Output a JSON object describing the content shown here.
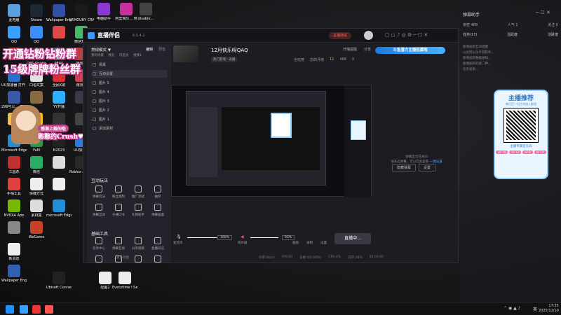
{
  "desktop": {
    "col1": [
      {
        "l": "此电脑",
        "c": "#5aa0e0"
      },
      {
        "l": "QQ",
        "c": "#3aa0ff"
      },
      {
        "l": "",
        "c": "#c04040"
      },
      {
        "l": "UU加速器 打开 小组件",
        "c": "#2a70c8"
      },
      {
        "l": "299号公... 产品号",
        "c": "#3a58a8"
      },
      {
        "l": "",
        "c": "#f0c040"
      },
      {
        "l": "Microsoft Edge",
        "c": "#1f8fd8"
      },
      {
        "l": "三国杀",
        "c": "#c03030"
      },
      {
        "l": "手柄工具",
        "c": "#e04040"
      },
      {
        "l": "NVIDIA App",
        "c": "#76b900"
      },
      {
        "l": "",
        "c": "#888"
      },
      {
        "l": "新消息",
        "c": "#eee"
      },
      {
        "l": "Wallpaper Engine",
        "c": "#3060b0"
      }
    ],
    "col2": [
      {
        "l": "Steam",
        "c": "#1b2838"
      },
      {
        "l": "QQ",
        "c": "#3a90ff"
      },
      {
        "l": "OBS Studio",
        "c": "#302e31"
      },
      {
        "l": "口语文案",
        "c": "#e0e0e0"
      },
      {
        "l": "",
        "c": "#8a6a40"
      },
      {
        "l": "YY语音",
        "c": "#f4c20d"
      },
      {
        "l": "FaM",
        "c": "#2a9a4a"
      },
      {
        "l": "微信",
        "c": "#2aae67"
      },
      {
        "l": "快捷方式",
        "c": "#eee"
      },
      {
        "l": "素材集",
        "c": "#ddd"
      },
      {
        "l": "WeGame",
        "c": "#c8402a"
      }
    ],
    "col3": [
      {
        "l": "Wallpaper Engine...",
        "c": "#3050a8"
      },
      {
        "l": "",
        "c": "#e04848"
      },
      {
        "l": "PEAK",
        "c": "#4a6080"
      },
      {
        "l": "全民K歌",
        "c": "#d83030"
      },
      {
        "l": "YY开播",
        "c": "#2ab0ff"
      },
      {
        "l": "",
        "c": "#333"
      },
      {
        "l": "N2023",
        "c": "#222"
      },
      {
        "l": "",
        "c": "#ddd"
      },
      {
        "l": "",
        "c": "#eee"
      },
      {
        "l": "microsoft Edge",
        "c": "#1f8fd8"
      }
    ],
    "col4": [
      {
        "l": "ARMOURY CRATE",
        "c": "#1a1a1a"
      },
      {
        "l": "微信开发",
        "c": "#44bb66"
      },
      {
        "l": "播放器",
        "c": "#b84040"
      },
      {
        "l": "南京...",
        "c": "#d04050"
      },
      {
        "l": "",
        "c": "#3a3a4a"
      },
      {
        "l": "",
        "c": "#444"
      },
      {
        "l": "UU加速器",
        "c": "#2a7ae0"
      },
      {
        "l": "Roblox Player",
        "c": "#2a2a2a"
      }
    ],
    "extra": [
      {
        "l": "电脑助手",
        "c": "#8a3ad0"
      },
      {
        "l": "阿里简历... 地",
        "c": "#c830a0"
      },
      {
        "l": "disable...",
        "c": "#444"
      },
      {
        "l": "配图2",
        "c": "#eee"
      },
      {
        "l": "Everytime I See a Dl...",
        "c": "#eee"
      },
      {
        "l": "Ubisoft Connect",
        "c": "#222"
      }
    ]
  },
  "overlay": {
    "line1": "开通钻粉钻粉群",
    "line2": "15级牌牌粉丝群",
    "badge": "感谢上舰的啦",
    "name": "憨憨的Crush♥"
  },
  "app": {
    "name": "直播伴侣",
    "version": "6.5.4.2",
    "live_btn": "主播测试",
    "panel_title": "常规模式 ▼",
    "tabs": [
      "编辑",
      "预告"
    ],
    "row_tabs": [
      "我的场景",
      "预览",
      "可选光",
      "视频1"
    ],
    "room_title": "12月快乐呀QAQ",
    "room_sub": "热门游戏 · 去播",
    "topbar": [
      "开播提醒",
      "分享"
    ],
    "banner": "斗鱼潜力主播招募啦",
    "stats": [
      "全站榜",
      "您的月榜",
      "11",
      "488",
      "0"
    ],
    "sources": [
      "场景",
      "互动设置",
      "图片 5",
      "图片 4",
      "图片 3",
      "图片 2",
      "图片 1",
      "添加素材"
    ],
    "sec1": "互动玩法",
    "sec1_items": [
      "弹幕玩法",
      "粉丝福利",
      "推广测试",
      "抽奖",
      "弹幕互动",
      "主播口令",
      "礼物助手",
      "弹幕画面"
    ],
    "sec2": "基础工具",
    "sec2_items": [
      "任务中心",
      "弹幕互动",
      "分享链接",
      "直播间信",
      "弹幕发",
      "房间安全",
      "播放器",
      "下播预约",
      "显示"
    ],
    "more": "更多功能",
    "preview_txt": [
      "弹幕显示已关闭",
      "请开启弹幕，可以在此查看",
      "一键设置"
    ],
    "preview_btns": [
      "隐藏弹幕",
      "设置"
    ],
    "bottom": [
      "麦克风",
      "100%",
      "扬声器",
      "93%",
      "截图",
      "录制",
      "设置"
    ],
    "live": "直播中...",
    "status": [
      "码率:0kb/s",
      "FPS:60",
      "丢帧:0(0.00%)",
      "CPU:4%",
      "内存:26%",
      "00:00:00"
    ]
  },
  "side": {
    "title": "弹幕助手",
    "stats": [
      {
        "l": "亲密 488"
      },
      {
        "l": "人气 1"
      },
      {
        "l": "关注 0"
      }
    ],
    "tabs": [
      "任务(17)",
      "活跃度",
      "活跃度"
    ],
    "msgs": [
      "新增加新互动提醒",
      "以达到以乐手游获利...",
      "新增加新数据通知...",
      "新增加新的第二种...",
      "任务发表..."
    ],
    "promo_title": "主播推荐",
    "promo_sub": "每日扫一扫方式加入群组",
    "promo_foot": "主播专属名礼码",
    "promo_tags": [
      "LV 10",
      "LV 12",
      "LV 8",
      "LV 14"
    ]
  },
  "taskbar": {
    "time": "17:55",
    "date": "2025/12/10",
    "lang": "英"
  }
}
